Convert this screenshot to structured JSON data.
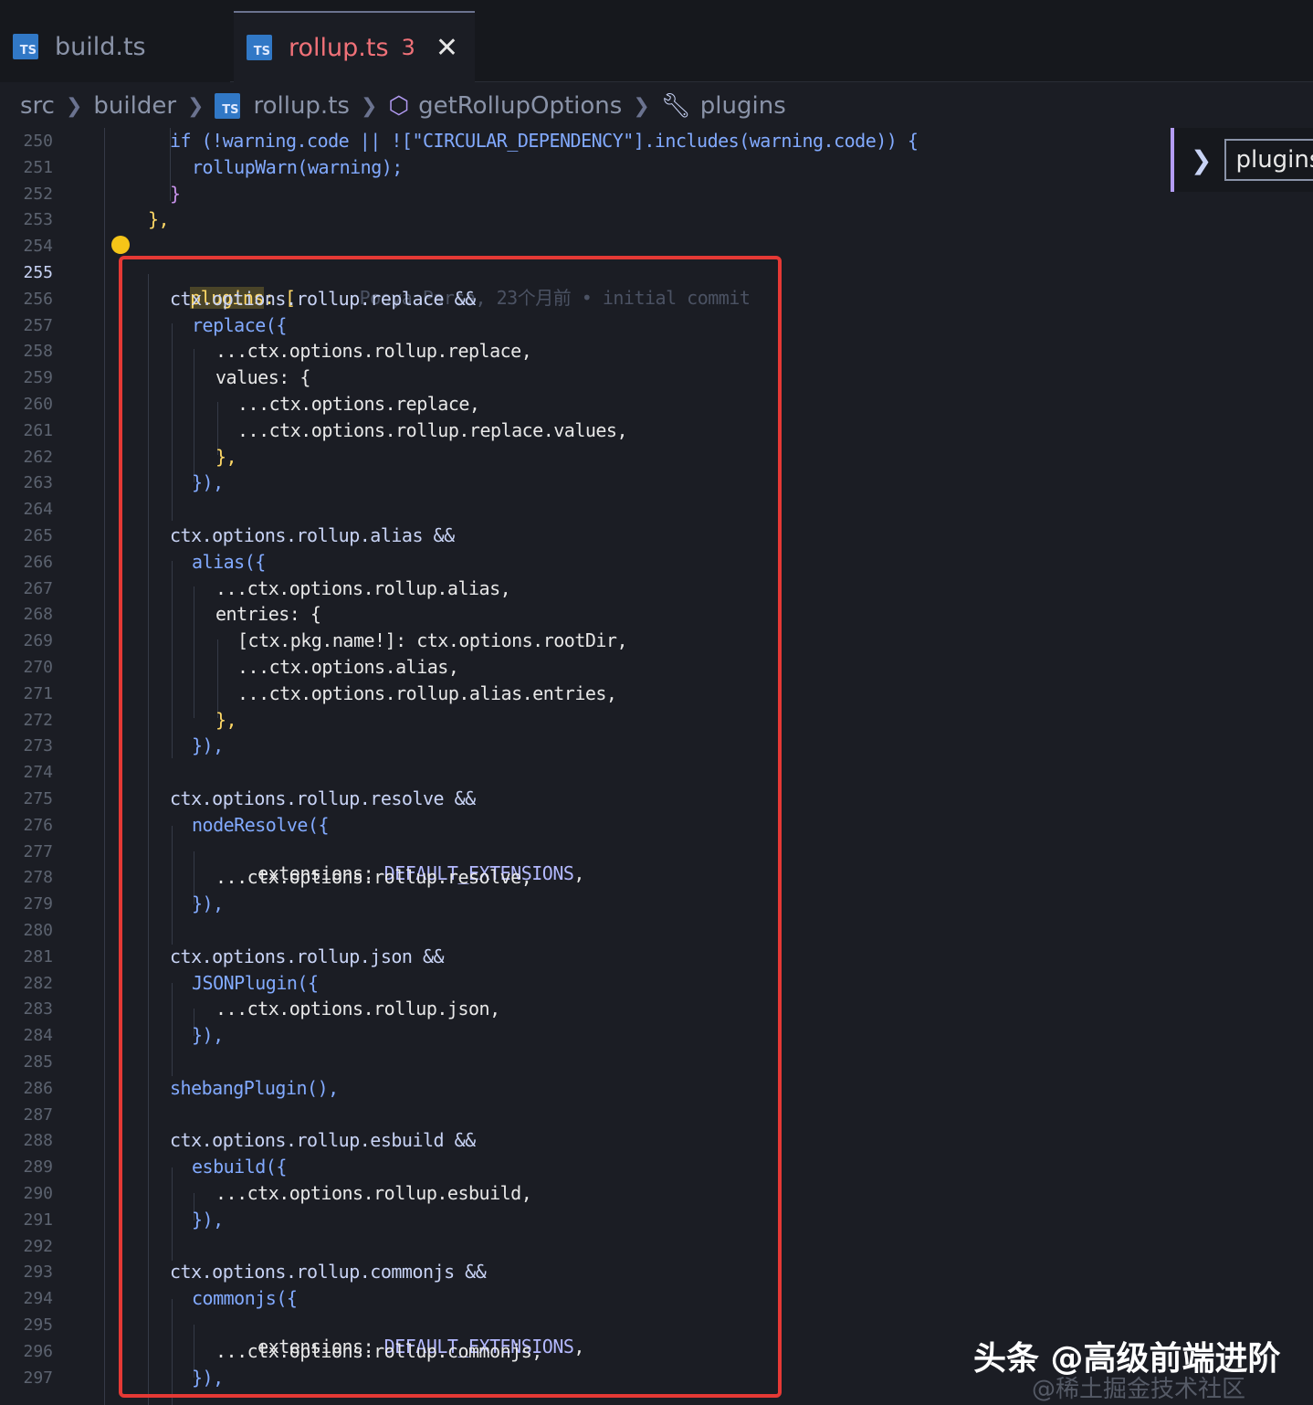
{
  "tabs": [
    {
      "label": "build.ts",
      "icon": "TS",
      "active": false
    },
    {
      "label": "rollup.ts",
      "icon": "TS",
      "active": true,
      "problems": "3",
      "close": "✕"
    }
  ],
  "breadcrumb": {
    "items": [
      "src",
      "builder",
      "rollup.ts",
      "getRollupOptions",
      "plugins"
    ]
  },
  "sticky": {
    "label": "plugins"
  },
  "blame": "Pooya Parsa, 23个月前 • initial commit",
  "lines": [
    {
      "n": "250"
    },
    {
      "n": "251"
    },
    {
      "n": "252"
    },
    {
      "n": "253"
    },
    {
      "n": "254"
    },
    {
      "n": "255"
    },
    {
      "n": "256"
    },
    {
      "n": "257"
    },
    {
      "n": "258"
    },
    {
      "n": "259"
    },
    {
      "n": "260"
    },
    {
      "n": "261"
    },
    {
      "n": "262"
    },
    {
      "n": "263"
    },
    {
      "n": "264"
    },
    {
      "n": "265"
    },
    {
      "n": "266"
    },
    {
      "n": "267"
    },
    {
      "n": "268"
    },
    {
      "n": "269"
    },
    {
      "n": "270"
    },
    {
      "n": "271"
    },
    {
      "n": "272"
    },
    {
      "n": "273"
    },
    {
      "n": "274"
    },
    {
      "n": "275"
    },
    {
      "n": "276"
    },
    {
      "n": "277"
    },
    {
      "n": "278"
    },
    {
      "n": "279"
    },
    {
      "n": "280"
    },
    {
      "n": "281"
    },
    {
      "n": "282"
    },
    {
      "n": "283"
    },
    {
      "n": "284"
    },
    {
      "n": "285"
    },
    {
      "n": "286"
    },
    {
      "n": "287"
    },
    {
      "n": "288"
    },
    {
      "n": "289"
    },
    {
      "n": "290"
    },
    {
      "n": "291"
    },
    {
      "n": "292"
    },
    {
      "n": "293"
    },
    {
      "n": "294"
    },
    {
      "n": "295"
    },
    {
      "n": "296"
    },
    {
      "n": "297"
    }
  ],
  "code": {
    "l250": "if (!warning.code || ![\"CIRCULAR_DEPENDENCY\"].includes(warning.code)) {",
    "l251": "rollupWarn(warning);",
    "l252": "}",
    "l253": "},",
    "l255a": "plugins",
    "l255b": ": [",
    "l256": "ctx.options.rollup.replace &&",
    "l257": "replace({",
    "l258": "...ctx.options.rollup.replace,",
    "l259": "values: {",
    "l260": "...ctx.options.replace,",
    "l261": "...ctx.options.rollup.replace.values,",
    "l262": "},",
    "l263": "}),",
    "l265": "ctx.options.rollup.alias &&",
    "l266": "alias({",
    "l267": "...ctx.options.rollup.alias,",
    "l268": "entries: {",
    "l269": "[ctx.pkg.name!]: ctx.options.rootDir,",
    "l270": "...ctx.options.alias,",
    "l271": "...ctx.options.rollup.alias.entries,",
    "l272": "},",
    "l273": "}),",
    "l275": "ctx.options.rollup.resolve &&",
    "l276": "nodeResolve({",
    "l277a": "extensions: ",
    "l277b": "DEFAULT_EXTENSIONS",
    "l277c": ",",
    "l278": "...ctx.options.rollup.resolve,",
    "l279": "}),",
    "l281": "ctx.options.rollup.json &&",
    "l282": "JSONPlugin({",
    "l283": "...ctx.options.rollup.json,",
    "l284": "}),",
    "l286": "shebangPlugin(),",
    "l288": "ctx.options.rollup.esbuild &&",
    "l289": "esbuild({",
    "l290": "...ctx.options.rollup.esbuild,",
    "l291": "}),",
    "l293": "ctx.options.rollup.commonjs &&",
    "l294": "commonjs({",
    "l295a": "extensions: ",
    "l295b": "DEFAULT_EXTENSIONS",
    "l295c": ",",
    "l296": "...ctx.options.rollup.commonjs,",
    "l297": "}),"
  },
  "watermark": {
    "main": "头条 @高级前端进阶",
    "sub": "@稀土掘金技术社区"
  },
  "colors": {
    "accent": "#f07178",
    "highlight_box": "#e53935",
    "background": "#1b1d24"
  }
}
